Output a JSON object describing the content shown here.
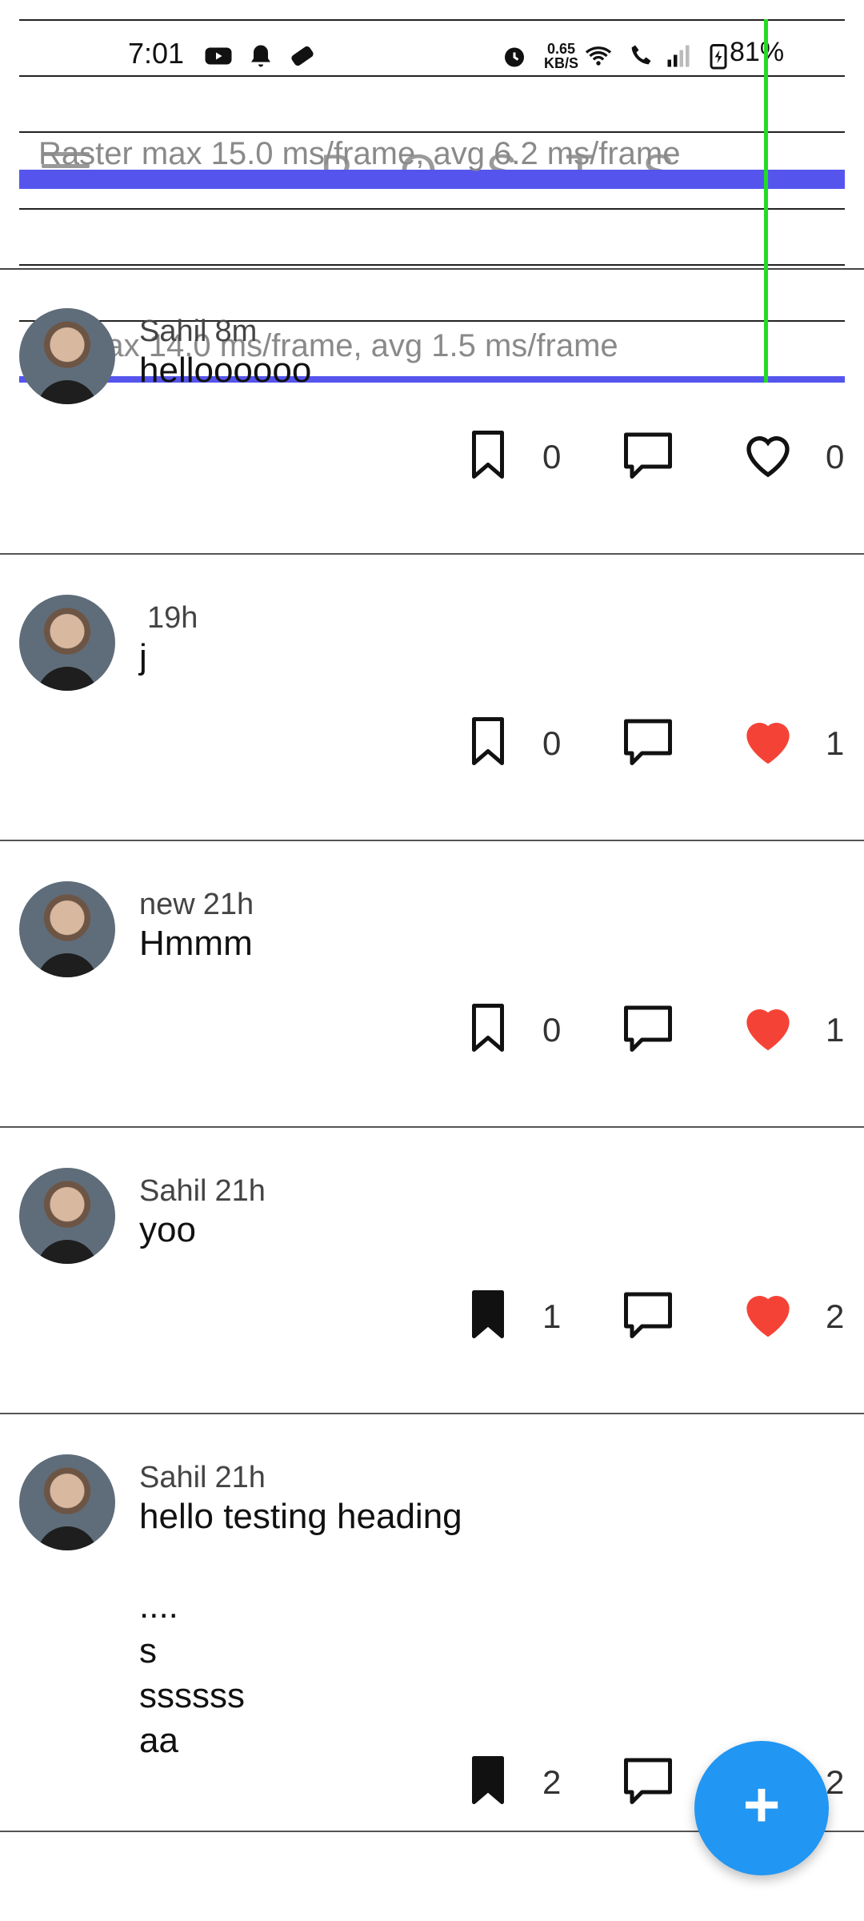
{
  "status_bar": {
    "time": "7:01",
    "net_speed_value": "0.65",
    "net_speed_unit": "KB/S",
    "battery": "81%"
  },
  "app_bar": {
    "title": "P O S T S"
  },
  "perf_overlay": {
    "raster_label": "Raster  max 15.0 ms/frame, avg 6.2 ms/frame",
    "ui_label": "UI  max 14.0 ms/frame, avg 1.5 ms/frame"
  },
  "posts": [
    {
      "author": "Sahil",
      "time": "8m",
      "text": "helloooooo",
      "bookmarks": "0",
      "comments": "",
      "likes": "0",
      "bookmarked": false,
      "liked": false
    },
    {
      "author": "",
      "time": "19h",
      "text": "j",
      "bookmarks": "0",
      "comments": "",
      "likes": "1",
      "bookmarked": false,
      "liked": true
    },
    {
      "author": "new",
      "time": "21h",
      "text": "Hmmm",
      "bookmarks": "0",
      "comments": "",
      "likes": "1",
      "bookmarked": false,
      "liked": true
    },
    {
      "author": "Sahil",
      "time": "21h",
      "text": "yoo",
      "bookmarks": "1",
      "comments": "",
      "likes": "2",
      "bookmarked": true,
      "liked": true
    },
    {
      "author": "Sahil",
      "time": "21h",
      "text": "hello testing heading\n\n....\ns\nssssss\naa",
      "bookmarks": "2",
      "comments": "",
      "likes": "2",
      "bookmarked": true,
      "liked": true
    }
  ],
  "fab": {
    "label": "+"
  },
  "colors": {
    "accent": "#2196f3",
    "like": "#f44336",
    "perf_bar": "#5555ee",
    "perf_marker": "#22dd22"
  }
}
